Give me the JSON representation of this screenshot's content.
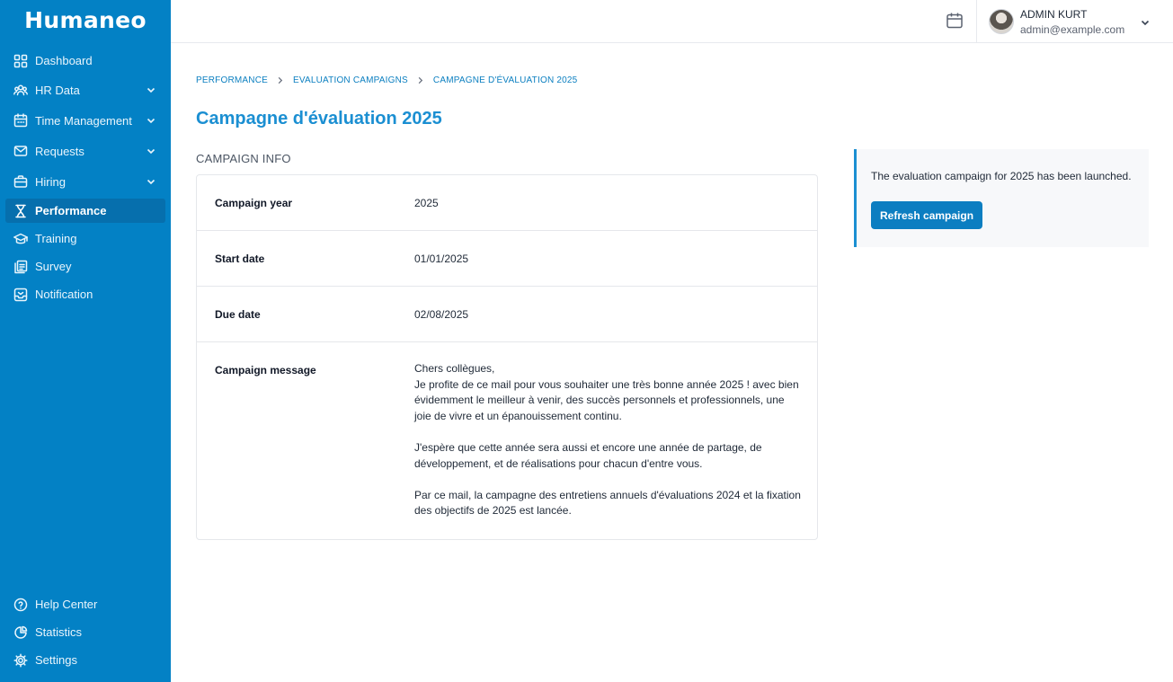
{
  "app": {
    "brand": "Humaneo"
  },
  "sidebar": {
    "items": [
      {
        "label": "Dashboard",
        "icon": "grid-icon",
        "expandable": false,
        "active": false
      },
      {
        "label": "HR Data",
        "icon": "users-icon",
        "expandable": true,
        "active": false
      },
      {
        "label": "Time Management",
        "icon": "calendar-icon",
        "expandable": true,
        "active": false
      },
      {
        "label": "Requests",
        "icon": "mail-icon",
        "expandable": true,
        "active": false
      },
      {
        "label": "Hiring",
        "icon": "briefcase-icon",
        "expandable": true,
        "active": false
      },
      {
        "label": "Performance",
        "icon": "hourglass-icon",
        "expandable": false,
        "active": true
      },
      {
        "label": "Training",
        "icon": "graduation-cap-icon",
        "expandable": false,
        "active": false
      },
      {
        "label": "Survey",
        "icon": "clipboard-icon",
        "expandable": false,
        "active": false
      },
      {
        "label": "Notification",
        "icon": "inbox-icon",
        "expandable": false,
        "active": false
      }
    ],
    "bottom_items": [
      {
        "label": "Help Center",
        "icon": "help-circle-icon"
      },
      {
        "label": "Statistics",
        "icon": "pie-chart-icon"
      },
      {
        "label": "Settings",
        "icon": "gear-icon"
      }
    ]
  },
  "topbar": {
    "user_name": "ADMIN KURT",
    "user_email": "admin@example.com"
  },
  "breadcrumb": [
    "PERFORMANCE",
    "EVALUATION CAMPAIGNS",
    "CAMPAGNE D'ÉVALUATION 2025"
  ],
  "page": {
    "title": "Campagne d'évaluation 2025",
    "section_title": "CAMPAIGN INFO"
  },
  "campaign_info": {
    "rows": [
      {
        "label": "Campaign year",
        "value": "2025"
      },
      {
        "label": "Start date",
        "value": "01/01/2025"
      },
      {
        "label": "Due date",
        "value": "02/08/2025"
      },
      {
        "label": "Campaign message",
        "value": "Chers collègues,\n Je profite de ce mail pour vous souhaiter une très bonne année 2025 ! avec bien évidemment le meilleur à venir, des succès personnels et professionnels, une joie de vivre et un épanouissement continu.\n\n J'espère que cette année sera aussi et encore une année de partage, de développement, et de réalisations pour chacun d'entre vous.\n\n Par ce mail, la campagne des entretiens annuels d'évaluations 2024 et la fixation des objectifs de 2025 est lancée."
      }
    ]
  },
  "notice": {
    "text": "The evaluation campaign for 2025 has been launched.",
    "button_label": "Refresh campaign"
  },
  "colors": {
    "sidebar_bg": "#0381c5",
    "active_item_bg": "#066fad",
    "accent": "#1b8fd2",
    "button_bg": "#0c7ec1"
  }
}
